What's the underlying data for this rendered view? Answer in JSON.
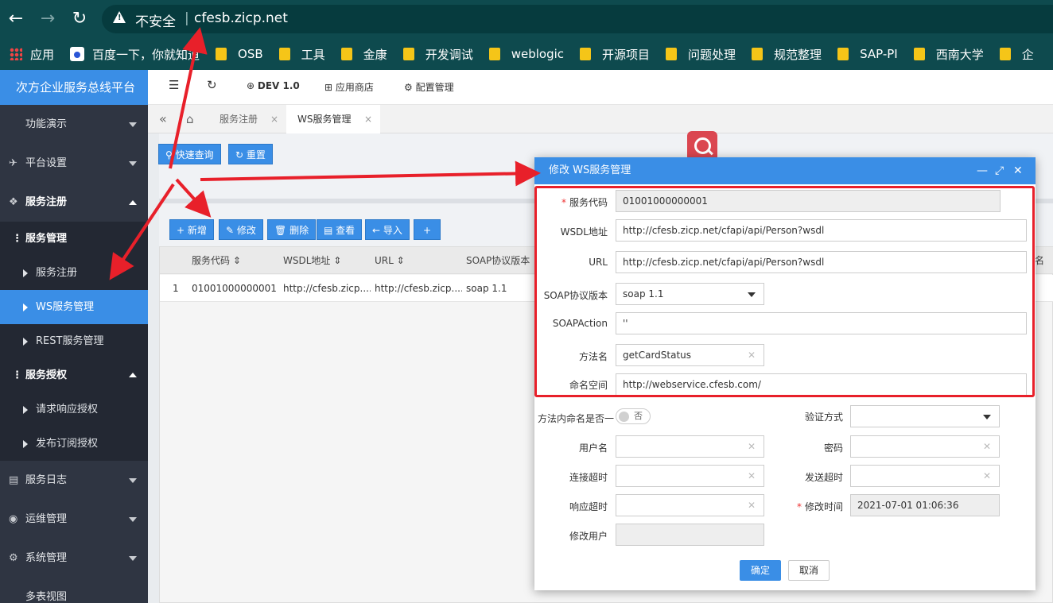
{
  "browser": {
    "insecure_label": "不安全",
    "separator": "|",
    "url": "cfesb.zicp.net",
    "bookmarks": [
      "应用",
      "百度一下，你就知道",
      "OSB",
      "工具",
      "金康",
      "开发调试",
      "weblogic",
      "开源项目",
      "问题处理",
      "规范整理",
      "SAP-PI",
      "西南大学",
      "企"
    ]
  },
  "sidebar": {
    "brand": "次方企业服务总线平台",
    "items": [
      {
        "label": "功能演示"
      },
      {
        "label": "平台设置"
      },
      {
        "label": "服务注册"
      }
    ],
    "group1_title": "服务管理",
    "group1_items": [
      "服务注册",
      "WS服务管理",
      "REST服务管理"
    ],
    "group2_title": "服务授权",
    "group2_items": [
      "请求响应授权",
      "发布订阅授权"
    ],
    "bottom_items": [
      "服务日志",
      "运维管理",
      "系统管理",
      "多表视图"
    ]
  },
  "toolbar": {
    "env": "DEV 1.0",
    "app_store": "应用商店",
    "config": "配置管理"
  },
  "tabs": [
    "服务注册",
    "WS服务管理"
  ],
  "actions": {
    "quick_search": "快速查询",
    "reset": "重置",
    "add": "新增",
    "edit": "修改",
    "delete": "删除",
    "view": "查看",
    "import": "导入",
    "plus": "+"
  },
  "grid": {
    "columns": [
      "服务代码",
      "WSDL地址",
      "URL",
      "SOAP协议版本",
      "名"
    ],
    "rows": [
      {
        "index": "1",
        "code": "01001000000001",
        "wsdl": "http://cfesb.zicp....",
        "url": "http://cfesb.zicp....",
        "soap": "soap 1.1"
      }
    ]
  },
  "dialog": {
    "title": "修改 WS服务管理",
    "fields": {
      "service_code": {
        "label": "服务代码",
        "value": "01001000000001"
      },
      "wsdl": {
        "label": "WSDL地址",
        "value": "http://cfesb.zicp.net/cfapi/api/Person?wsdl"
      },
      "url": {
        "label": "URL",
        "value": "http://cfesb.zicp.net/cfapi/api/Person?wsdl"
      },
      "soap_version": {
        "label": "SOAP协议版本",
        "value": "soap 1.1"
      },
      "soap_action": {
        "label": "SOAPAction",
        "value": "''"
      },
      "method": {
        "label": "方法名",
        "value": "getCardStatus"
      },
      "namespace": {
        "label": "命名空间",
        "value": "http://webservice.cfesb.com/"
      },
      "method_ns": {
        "label": "方法内命名是否一",
        "toggle": "否"
      },
      "auth": {
        "label": "验证方式",
        "value": ""
      },
      "username": {
        "label": "用户名",
        "value": ""
      },
      "password": {
        "label": "密码",
        "value": ""
      },
      "conn_timeout": {
        "label": "连接超时",
        "value": ""
      },
      "send_timeout": {
        "label": "发送超时",
        "value": ""
      },
      "resp_timeout": {
        "label": "响应超时",
        "value": ""
      },
      "modify_time": {
        "label": "修改时间",
        "value": "2021-07-01 01:06:36"
      },
      "modify_user": {
        "label": "修改用户",
        "value": ""
      }
    },
    "ok": "确定",
    "cancel": "取消"
  },
  "colors": {
    "accent": "#3a8ee6",
    "sidebar_bg": "#2f3542",
    "browser_bg": "#0e4a4e",
    "annotation_red": "#e8202a"
  }
}
